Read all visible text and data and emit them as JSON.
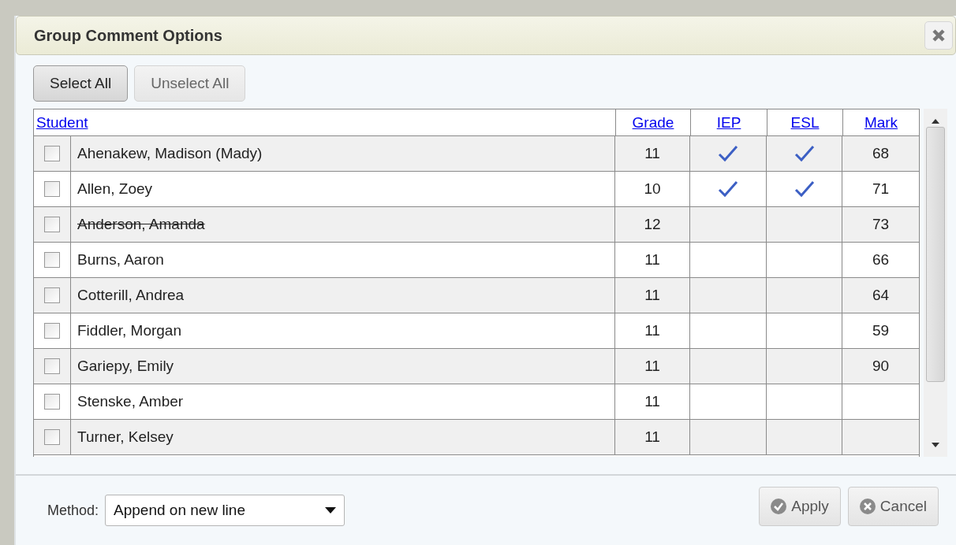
{
  "dialog": {
    "title": "Group Comment Options"
  },
  "toolbar": [
    {
      "label": "Select All",
      "disabled": false
    },
    {
      "label": "Unselect All",
      "disabled": true
    }
  ],
  "table": {
    "columns": [
      {
        "label": "Student"
      },
      {
        "label": "Grade"
      },
      {
        "label": "IEP"
      },
      {
        "label": "ESL"
      },
      {
        "label": "Mark"
      }
    ],
    "rows": [
      {
        "selected": false,
        "name": "Ahenakew, Madison (Mady)",
        "withdrawn": false,
        "grade": "11",
        "iep": true,
        "esl": true,
        "mark": "68"
      },
      {
        "selected": false,
        "name": "Allen, Zoey",
        "withdrawn": false,
        "grade": "10",
        "iep": true,
        "esl": true,
        "mark": "71"
      },
      {
        "selected": false,
        "name": "Anderson, Amanda",
        "withdrawn": true,
        "grade": "12",
        "iep": false,
        "esl": false,
        "mark": "73"
      },
      {
        "selected": false,
        "name": "Burns, Aaron",
        "withdrawn": false,
        "grade": "11",
        "iep": false,
        "esl": false,
        "mark": "66"
      },
      {
        "selected": false,
        "name": "Cotterill, Andrea",
        "withdrawn": false,
        "grade": "11",
        "iep": false,
        "esl": false,
        "mark": "64"
      },
      {
        "selected": false,
        "name": "Fiddler, Morgan",
        "withdrawn": false,
        "grade": "11",
        "iep": false,
        "esl": false,
        "mark": "59"
      },
      {
        "selected": false,
        "name": "Gariepy, Emily",
        "withdrawn": false,
        "grade": "11",
        "iep": false,
        "esl": false,
        "mark": "90"
      },
      {
        "selected": false,
        "name": "Stenske, Amber",
        "withdrawn": false,
        "grade": "11",
        "iep": false,
        "esl": false
      },
      {
        "selected": false,
        "name": "Turner, Kelsey",
        "withdrawn": false,
        "grade": "11",
        "iep": false,
        "esl": false
      }
    ]
  },
  "footer": {
    "method_label": "Method:",
    "method_value": "Append on new line",
    "buttons": [
      {
        "kind": "apply",
        "label": "Apply"
      },
      {
        "kind": "cancel",
        "label": "Cancel"
      }
    ]
  }
}
